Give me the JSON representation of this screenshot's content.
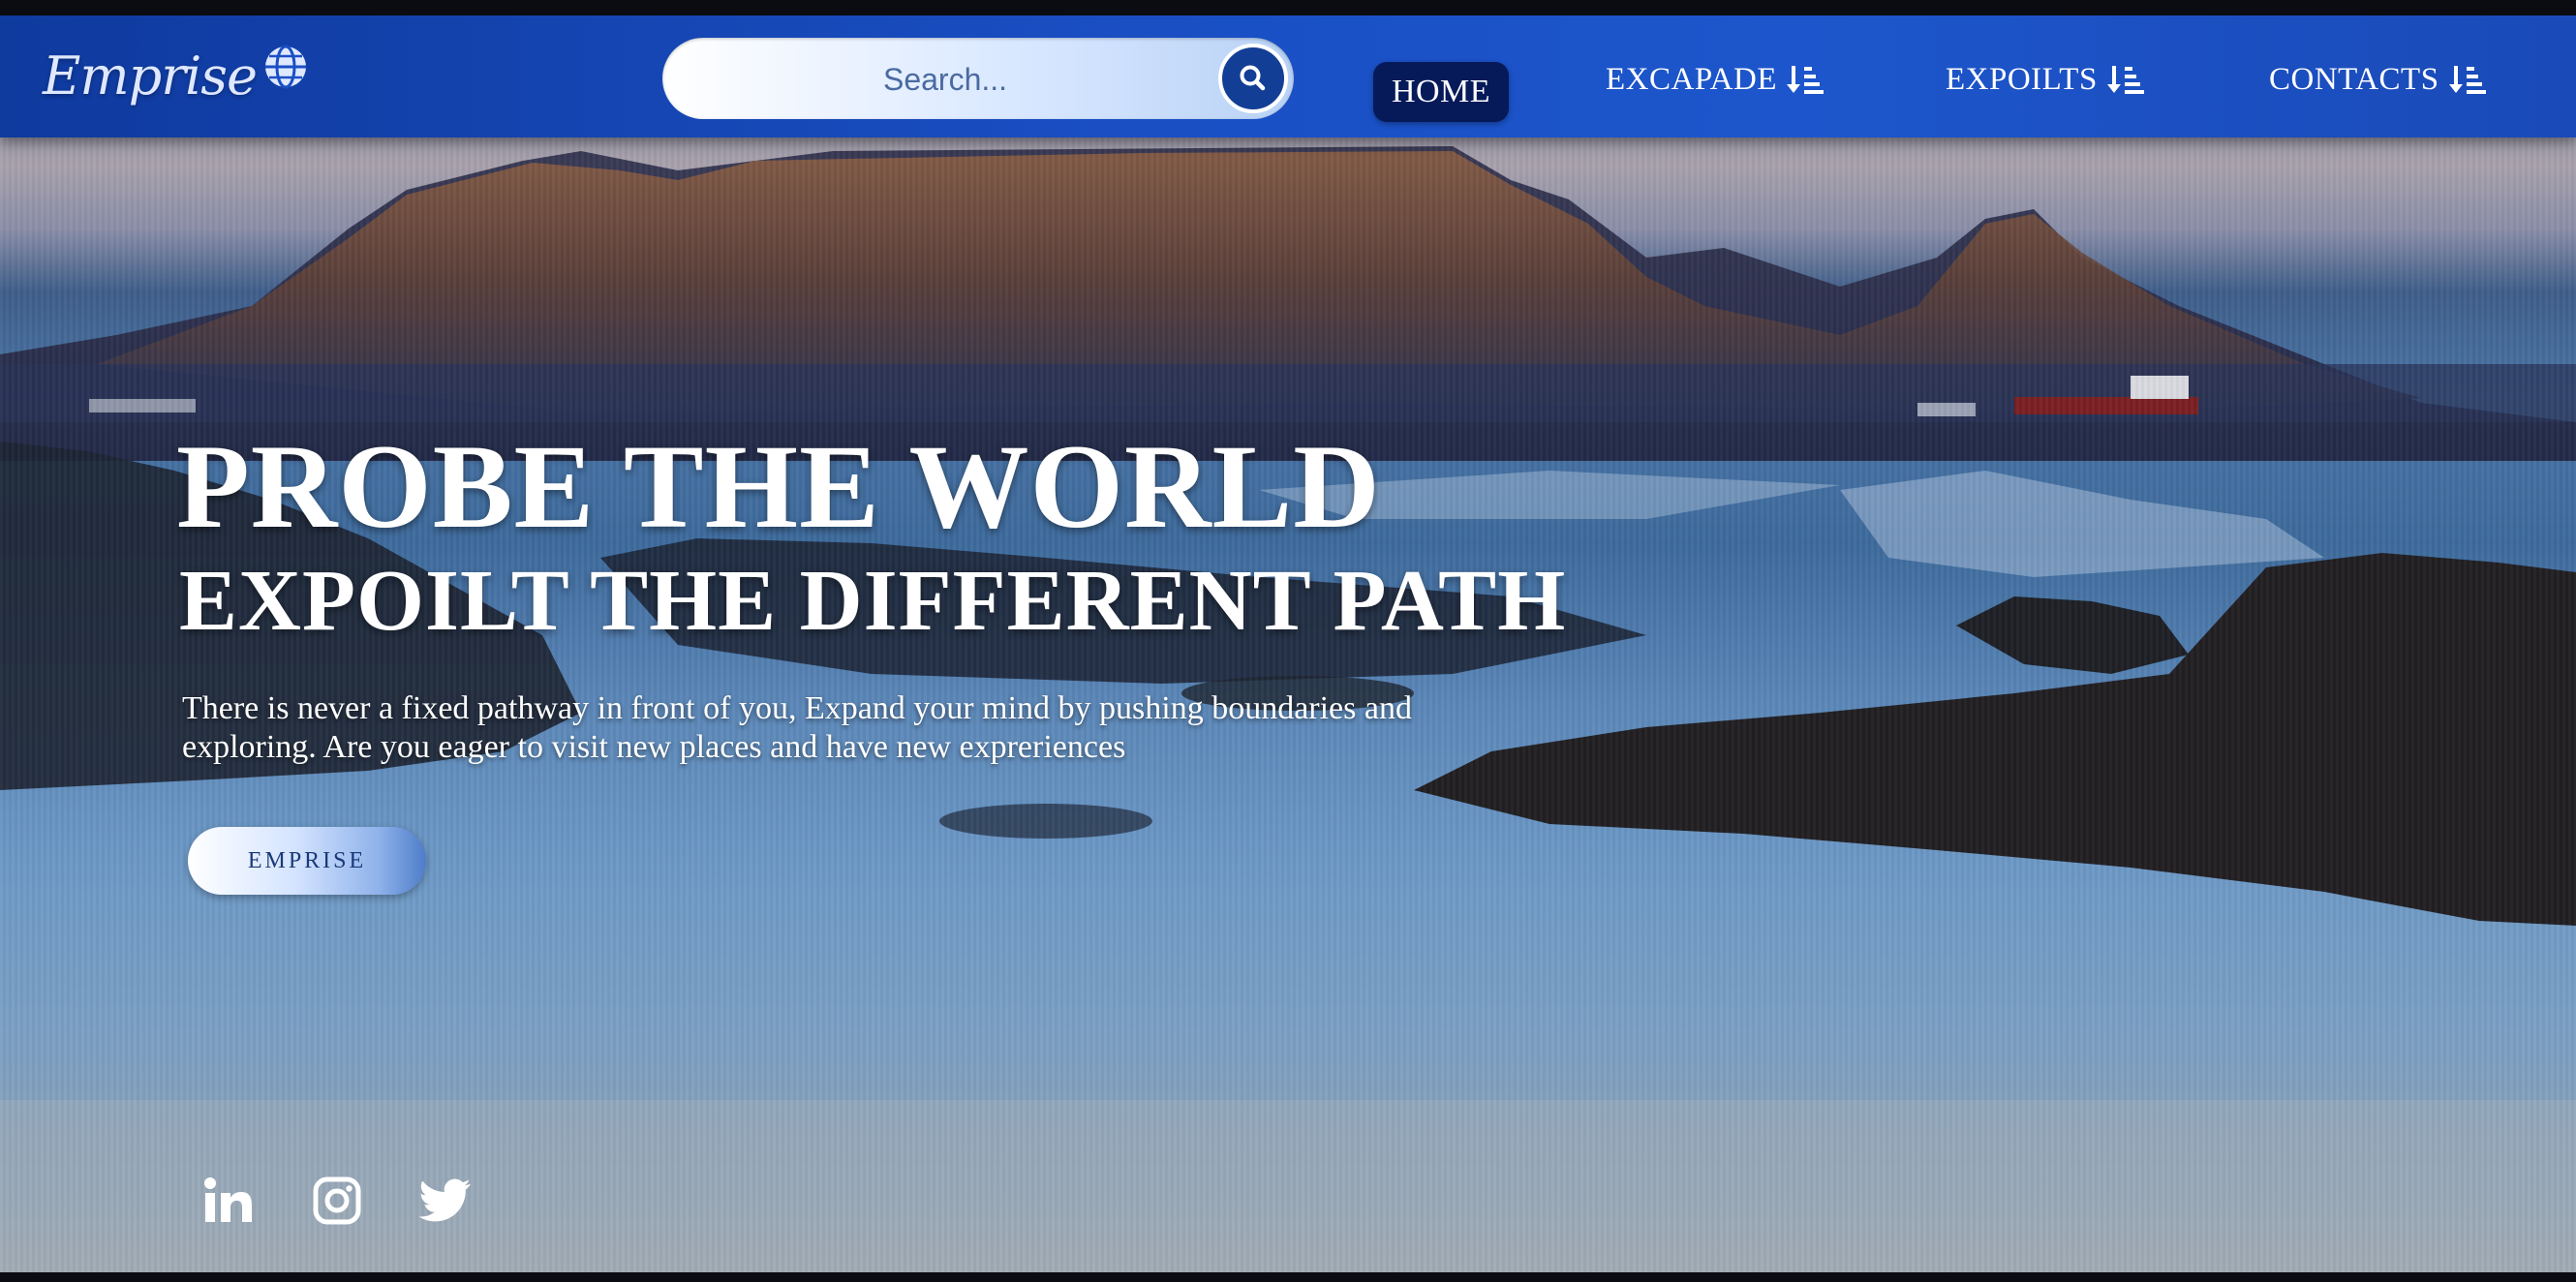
{
  "brand": {
    "logo_text": "Emprise"
  },
  "search": {
    "placeholder": "Search..."
  },
  "nav": {
    "home": "HOME",
    "items": [
      {
        "label": "EXCAPADE"
      },
      {
        "label": "EXPOILTS"
      },
      {
        "label": "CONTACTS"
      }
    ]
  },
  "hero": {
    "title": "PROBE THE WORLD",
    "subtitle": "EXPOILT THE DIFFERENT PATH",
    "text": "There is never a fixed pathway in front of you, Expand your mind by pushing boundaries and exploring. Are you eager to visit new places and have new expreriences",
    "button": "EMPRISE"
  },
  "social": [
    "linkedin-icon",
    "instagram-icon",
    "twitter-icon"
  ],
  "colors": {
    "navbar": "#1a4fc4",
    "nav_active": "#061a5a",
    "search_button": "#123e95",
    "text": "#ffffff"
  }
}
